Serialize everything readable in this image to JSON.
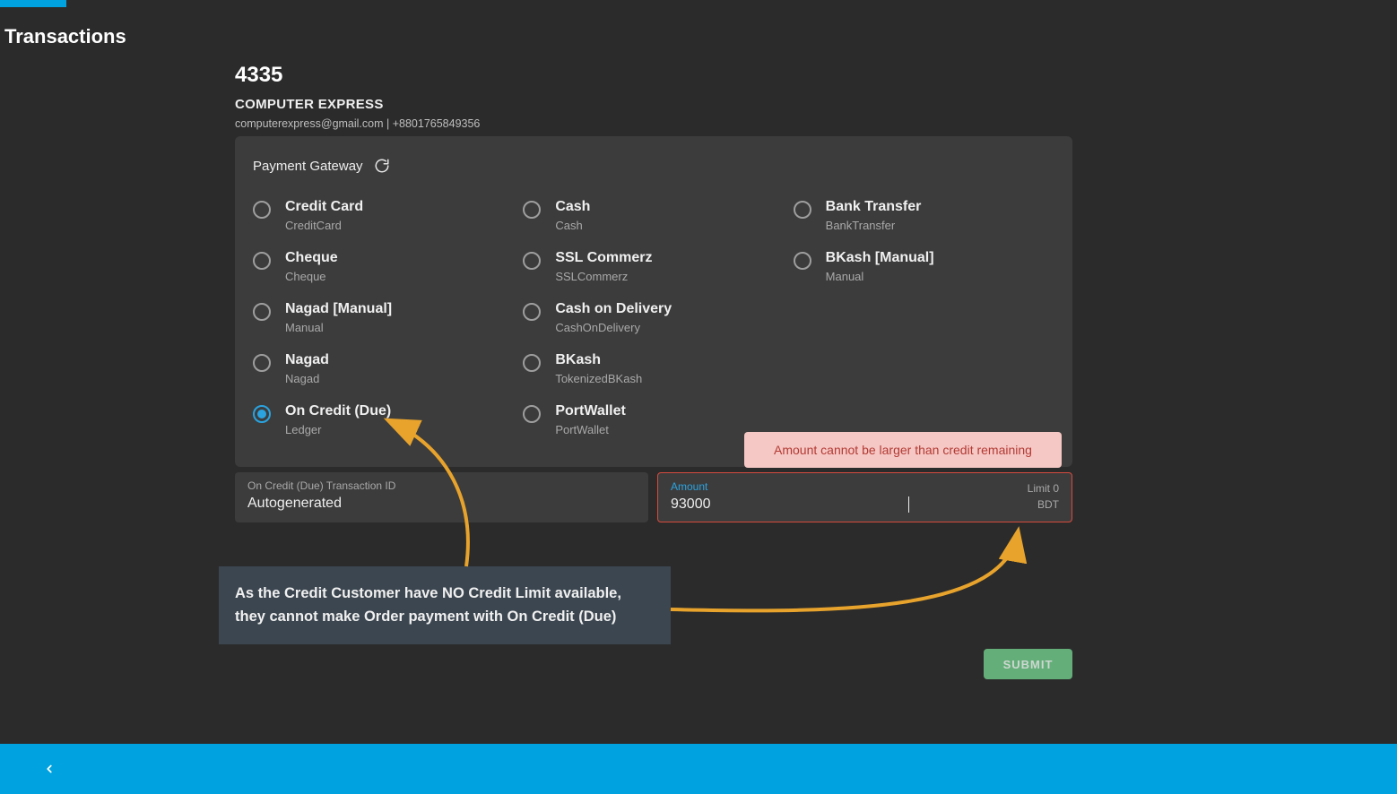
{
  "page": {
    "title": "Transactions"
  },
  "customer": {
    "id": "4335",
    "name": "COMPUTER EXPRESS",
    "contact": "computerexpress@gmail.com | +8801765849356"
  },
  "panel": {
    "title": "Payment Gateway"
  },
  "gateways": {
    "col1": [
      {
        "title": "Credit Card",
        "sub": "CreditCard",
        "checked": false
      },
      {
        "title": "Cheque",
        "sub": "Cheque",
        "checked": false
      },
      {
        "title": "Nagad [Manual]",
        "sub": "Manual",
        "checked": false
      },
      {
        "title": "Nagad",
        "sub": "Nagad",
        "checked": false
      },
      {
        "title": "On Credit (Due)",
        "sub": "Ledger",
        "checked": true
      }
    ],
    "col2": [
      {
        "title": "Cash",
        "sub": "Cash",
        "checked": false
      },
      {
        "title": "SSL Commerz",
        "sub": "SSLCommerz",
        "checked": false
      },
      {
        "title": "Cash on Delivery",
        "sub": "CashOnDelivery",
        "checked": false
      },
      {
        "title": "BKash",
        "sub": "TokenizedBKash",
        "checked": false
      },
      {
        "title": "PortWallet",
        "sub": "PortWallet",
        "checked": false
      }
    ],
    "col3": [
      {
        "title": "Bank Transfer",
        "sub": "BankTransfer",
        "checked": false
      },
      {
        "title": "BKash [Manual]",
        "sub": "Manual",
        "checked": false
      }
    ]
  },
  "fields": {
    "txn": {
      "label": "On Credit (Due) Transaction ID",
      "value": "Autogenerated"
    },
    "amount": {
      "label": "Amount",
      "value": "93000",
      "limit_label": "Limit 0",
      "currency": "BDT"
    }
  },
  "error": {
    "text": "Amount cannot be larger than credit remaining"
  },
  "note": {
    "text": "As the Credit Customer have NO Credit Limit available, they cannot make Order payment with On Credit (Due)"
  },
  "actions": {
    "submit": "SUBMIT"
  }
}
